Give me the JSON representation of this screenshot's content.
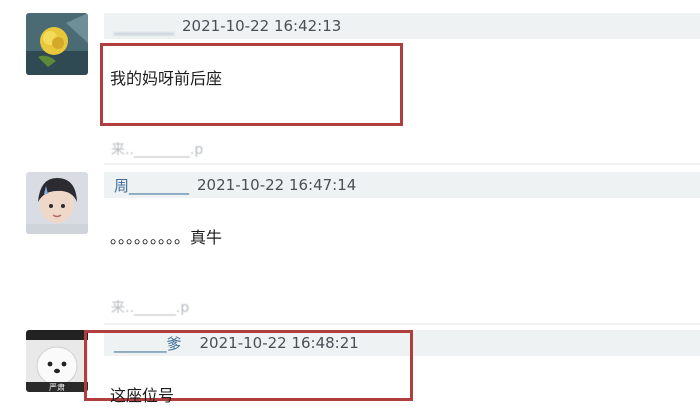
{
  "comments": [
    {
      "username": "________",
      "timestamp": "2021-10-22 16:42:13",
      "text": "我的妈呀前后座",
      "source": "来..________.p"
    },
    {
      "username": "周________",
      "timestamp": "2021-10-22 16:47:14",
      "text": "。。。。。。。。。真牛",
      "source": "来..______.p"
    },
    {
      "username": "_______爹",
      "timestamp": "2021-10-22 16:48:21",
      "text": "这座位号",
      "avatar_caption": "严肃"
    }
  ]
}
